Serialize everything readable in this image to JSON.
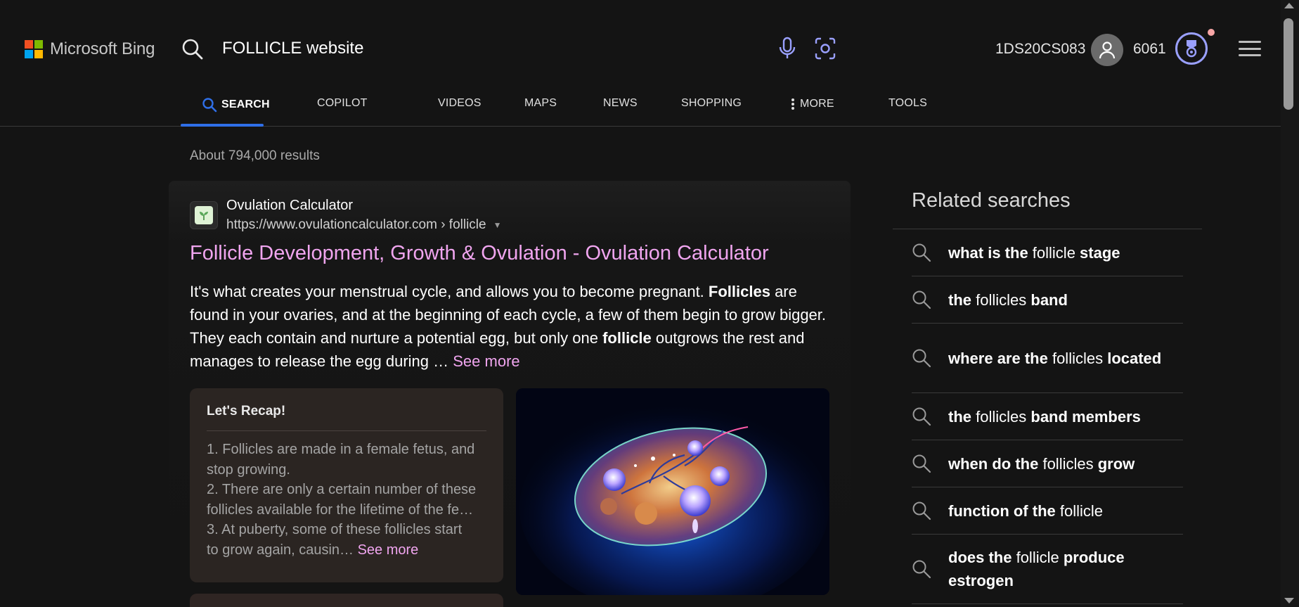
{
  "header": {
    "logo_text": "Microsoft Bing",
    "query": "FOLLICLE website",
    "user_id": "1DS20CS083",
    "points": "6061",
    "colors": {
      "accent": "#2f6fe8",
      "link": "#f0a5ef",
      "reward": "#9aa0ff"
    }
  },
  "tabs": [
    {
      "label": "SEARCH",
      "icon": "search-icon"
    },
    {
      "label": "COPILOT"
    },
    {
      "label": "VIDEOS"
    },
    {
      "label": "MAPS"
    },
    {
      "label": "NEWS"
    },
    {
      "label": "SHOPPING"
    },
    {
      "label": "MORE",
      "icon": "more-vertical-icon"
    },
    {
      "label": "TOOLS"
    }
  ],
  "results": {
    "count_text": "About 794,000 results",
    "first": {
      "site_name": "Ovulation Calculator",
      "url": "https://www.ovulationcalculator.com › follicle",
      "title": "Follicle Development, Growth & Ovulation - Ovulation Calculator",
      "snippet": {
        "p1": "It's what creates your menstrual cycle, and allows you to become pregnant. ",
        "b1": "Follicles",
        "p2": " are found in your ovaries, and at the beginning of each cycle, a few of them begin to grow bigger. They each contain and nurture a potential egg, but only one ",
        "b2": "follicle",
        "p3": " outgrows the rest and manages to release the egg during … ",
        "see_more": "See more"
      },
      "recap": {
        "title": "Let's Recap!",
        "lines": [
          "1. Follicles are made in a female fetus, and",
          "stop growing.",
          "2. There are only a certain number of these",
          "follicles available for the lifetime of the fe…",
          "3. At puberty, some of these follicles start",
          "to grow again, causin… "
        ],
        "see_more": "See more"
      }
    }
  },
  "related": {
    "title": "Related searches",
    "items": [
      [
        {
          "t": "what is the ",
          "b": true
        },
        {
          "t": "follicle ",
          "b": false
        },
        {
          "t": "stage",
          "b": true
        }
      ],
      [
        {
          "t": "the ",
          "b": true
        },
        {
          "t": "follicles ",
          "b": false
        },
        {
          "t": "band",
          "b": true
        }
      ],
      [
        {
          "t": "where are the ",
          "b": true
        },
        {
          "t": "follicles ",
          "b": false
        },
        {
          "t": "located",
          "b": true
        }
      ],
      [
        {
          "t": "the ",
          "b": true
        },
        {
          "t": "follicles ",
          "b": false
        },
        {
          "t": "band members",
          "b": true
        }
      ],
      [
        {
          "t": "when do the ",
          "b": true
        },
        {
          "t": "follicles ",
          "b": false
        },
        {
          "t": "grow",
          "b": true
        }
      ],
      [
        {
          "t": "function of the ",
          "b": true
        },
        {
          "t": "follicle",
          "b": false
        }
      ],
      [
        {
          "t": "does the ",
          "b": true
        },
        {
          "t": "follicle ",
          "b": false
        },
        {
          "t": "produce estrogen",
          "b": true
        }
      ]
    ]
  }
}
